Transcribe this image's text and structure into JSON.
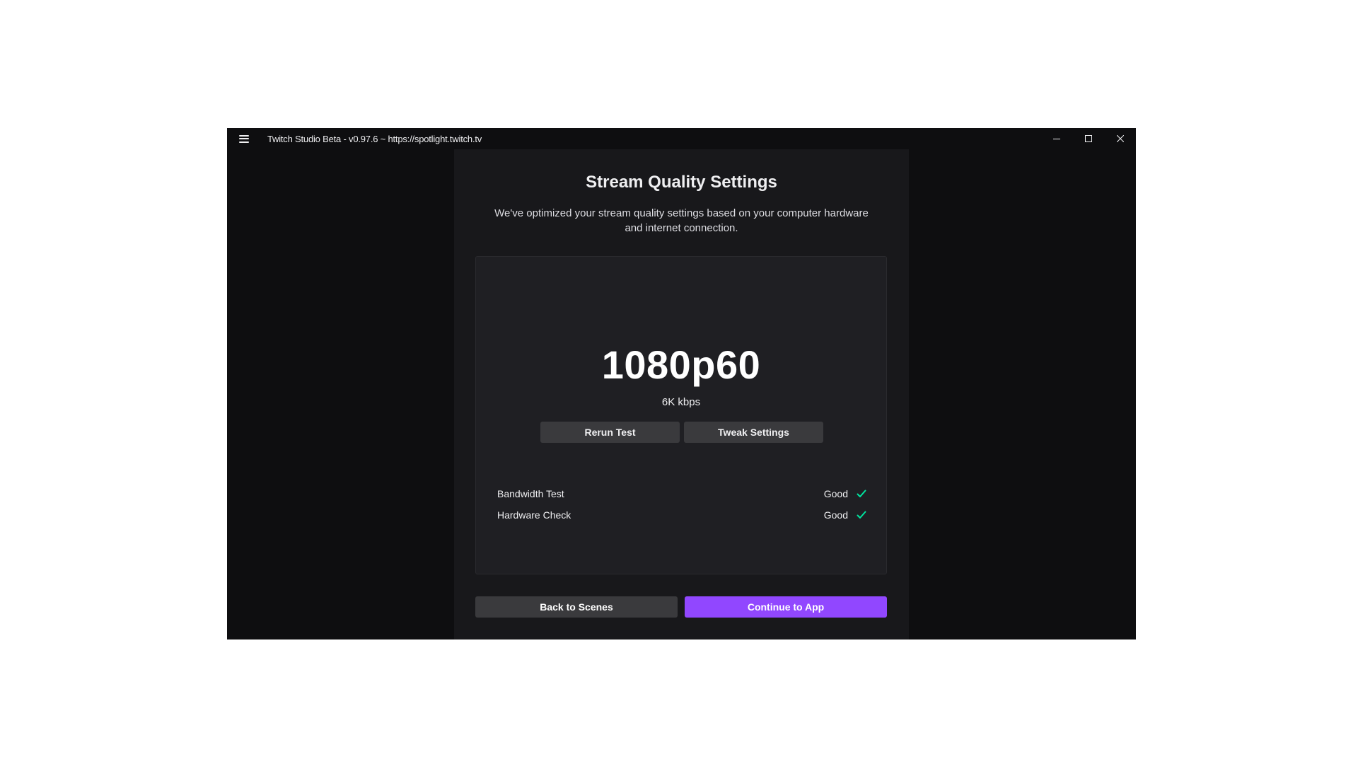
{
  "window": {
    "title": "Twitch Studio Beta - v0.97.6 ~ https://spotlight.twitch.tv",
    "controls": {
      "minimize_icon": "minimize-icon",
      "maximize_icon": "maximize-icon",
      "close_icon": "close-icon"
    },
    "menu_icon": "hamburger-menu-icon"
  },
  "page": {
    "title": "Stream Quality Settings",
    "description": "We've optimized your stream quality settings based on your computer hardware and internet connection."
  },
  "result": {
    "resolution": "1080p60",
    "bitrate": "6K kbps",
    "rerun_label": "Rerun Test",
    "tweak_label": "Tweak Settings"
  },
  "checks": [
    {
      "label": "Bandwidth Test",
      "status": "Good",
      "icon": "checkmark-icon"
    },
    {
      "label": "Hardware Check",
      "status": "Good",
      "icon": "checkmark-icon"
    }
  ],
  "footer": {
    "back_label": "Back to Scenes",
    "continue_label": "Continue to App"
  },
  "colors": {
    "accent": "#9147ff",
    "success": "#00e6a0",
    "window_bg": "#0e0e10",
    "panel_bg": "#18181b",
    "card_bg": "#1f1f23",
    "button_bg": "#3a3a3d"
  }
}
